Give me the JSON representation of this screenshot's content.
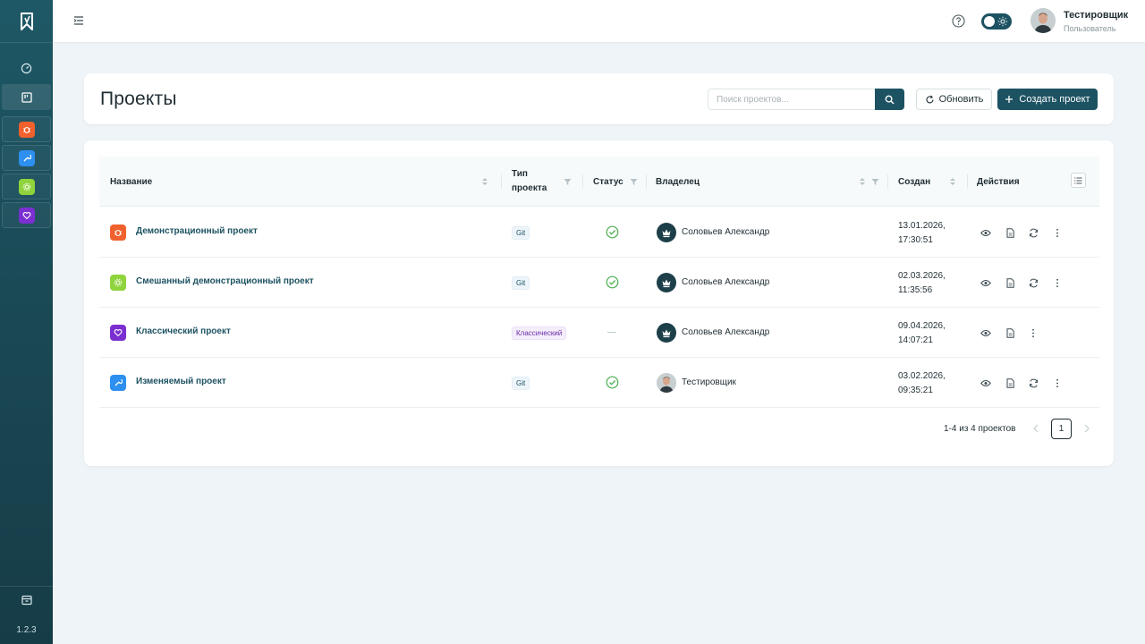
{
  "app": {
    "version": "1.2.3"
  },
  "sidebar": {
    "nav": [
      {
        "name": "dashboard",
        "icon": "gauge-icon"
      },
      {
        "name": "projects",
        "icon": "kanban-icon",
        "active": true
      }
    ],
    "projects": [
      {
        "name": "demo",
        "color": "#f0612e",
        "icon": "bug-icon"
      },
      {
        "name": "mutable",
        "color": "#2d8ff0",
        "icon": "wrench-icon"
      },
      {
        "name": "mixed",
        "color": "#8fd43c",
        "icon": "gear-icon"
      },
      {
        "name": "classic",
        "color": "#7b2fd0",
        "icon": "heart-icon"
      }
    ],
    "bottom_icon": "archive-icon"
  },
  "header": {
    "menu_icon": "menu-collapse-icon",
    "help_icon": "help-circle-icon",
    "theme_toggle_icon": "sun-icon",
    "user": {
      "name": "Тестировщик",
      "role": "Пользователь"
    }
  },
  "page": {
    "title": "Проекты",
    "search_placeholder": "Поиск проектов...",
    "refresh_label": "Обновить",
    "create_label": "Создать проект"
  },
  "table": {
    "columns": {
      "name": "Название",
      "type": "Тип проекта",
      "type_line1": "Тип",
      "type_line2": "проекта",
      "status": "Статус",
      "owner": "Владелец",
      "created": "Создан",
      "actions": "Действия"
    },
    "rows": [
      {
        "name": "Демонстрационный проект",
        "color": "#f0612e",
        "icon": "bug-icon",
        "type": "Git",
        "status": "ok",
        "owner": "Соловьев Александр",
        "owner_avatar": "crown-icon",
        "date": "13.01.2026,",
        "time": "17:30:51",
        "actions": [
          "view",
          "report",
          "sync",
          "more"
        ]
      },
      {
        "name": "Смешанный демонстрационный проект",
        "color": "#8fd43c",
        "icon": "gear-icon",
        "type": "Git",
        "status": "ok",
        "owner": "Соловьев Александр",
        "owner_avatar": "crown-icon",
        "date": "02.03.2026,",
        "time": "11:35:56",
        "actions": [
          "view",
          "report",
          "sync",
          "more"
        ]
      },
      {
        "name": "Классический проект",
        "color": "#7b2fd0",
        "icon": "heart-icon",
        "type": "Классический",
        "status": "none",
        "owner": "Соловьев Александр",
        "owner_avatar": "crown-icon",
        "date": "09.04.2026,",
        "time": "14:07:21",
        "actions": [
          "view",
          "report",
          "more"
        ]
      },
      {
        "name": "Изменяемый проект",
        "color": "#2d8ff0",
        "icon": "wrench-icon",
        "type": "Git",
        "status": "ok",
        "owner": "Тестировщик",
        "owner_avatar": "user-photo",
        "date": "03.02.2026,",
        "time": "09:35:21",
        "actions": [
          "view",
          "report",
          "sync",
          "more"
        ]
      }
    ]
  },
  "pagination": {
    "summary": "1-4 из 4 проектов",
    "current_page": "1"
  },
  "colors": {
    "brand": "#1d5262",
    "status_ok": "#4caf50"
  }
}
